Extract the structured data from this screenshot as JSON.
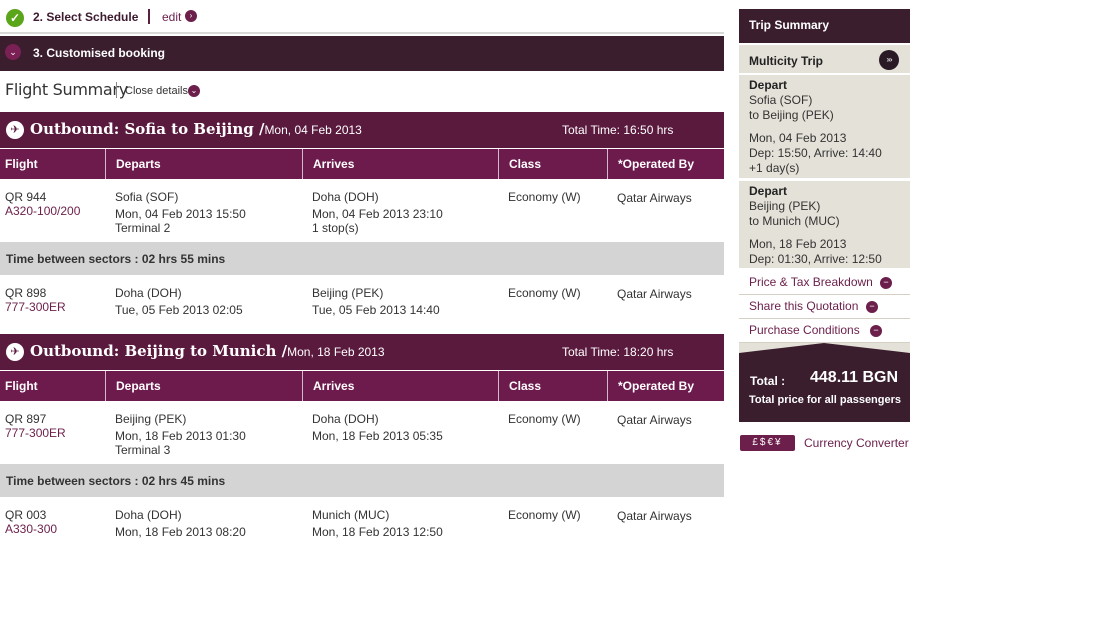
{
  "steps": {
    "step2": {
      "title": "2. Select Schedule",
      "edit": "edit"
    },
    "step3": {
      "title": "3. Customised booking"
    }
  },
  "summary": {
    "title": "Flight Summary",
    "close": "Close details"
  },
  "columns": [
    "Flight",
    "Departs",
    "Arrives",
    "Class",
    "*Operated By"
  ],
  "legs": [
    {
      "title": "Outbound: Sofia  to Beijing /",
      "date": "Mon, 04 Feb 2013",
      "total": "Total Time: 16:50 hrs",
      "segments": [
        {
          "flight": "QR 944",
          "aircraft": "A320-100/200",
          "dep_place": "Sofia (SOF)",
          "dep_time": "Mon, 04 Feb 2013 15:50",
          "dep_extra": "Terminal 2",
          "arr_place": "Doha (DOH)",
          "arr_time": "Mon, 04 Feb 2013 23:10",
          "arr_extra": "1 stop(s)",
          "class": "Economy (W)",
          "operator": "Qatar Airways"
        },
        {
          "flight": "QR 898",
          "aircraft": "777-300ER",
          "dep_place": "Doha (DOH)",
          "dep_time": "Tue, 05 Feb 2013 02:05",
          "dep_extra": "",
          "arr_place": "Beijing (PEK)",
          "arr_time": "Tue, 05 Feb 2013 14:40",
          "arr_extra": "",
          "class": "Economy (W)",
          "operator": "Qatar Airways"
        }
      ],
      "between": "Time between sectors : 02 hrs 55 mins"
    },
    {
      "title": "Outbound: Beijing  to Munich /",
      "date": "Mon, 18 Feb 2013",
      "total": "Total Time: 18:20 hrs",
      "segments": [
        {
          "flight": "QR 897",
          "aircraft": "777-300ER",
          "dep_place": "Beijing (PEK)",
          "dep_time": "Mon, 18 Feb 2013 01:30",
          "dep_extra": "Terminal 3",
          "arr_place": "Doha (DOH)",
          "arr_time": "Mon, 18 Feb 2013 05:35",
          "arr_extra": "",
          "class": "Economy (W)",
          "operator": "Qatar Airways"
        },
        {
          "flight": "QR 003",
          "aircraft": "A330-300",
          "dep_place": "Doha (DOH)",
          "dep_time": "Mon, 18 Feb 2013 08:20",
          "dep_extra": "",
          "arr_place": "Munich (MUC)",
          "arr_time": "Mon, 18 Feb 2013 12:50",
          "arr_extra": "",
          "class": "Economy (W)",
          "operator": "Qatar Airways"
        }
      ],
      "between": "Time between sectors : 02 hrs 45 mins"
    }
  ],
  "trip": {
    "title": "Trip Summary",
    "type": "Multicity Trip",
    "departs": [
      {
        "head": "Depart",
        "from": "Sofia (SOF)",
        "to": "to Beijing (PEK)",
        "date": "Mon, 04 Feb 2013",
        "times": "Dep: 15:50, Arrive: 14:40",
        "extra": "+1 day(s)"
      },
      {
        "head": "Depart",
        "from": "Beijing (PEK)",
        "to": "to Munich (MUC)",
        "date": "Mon, 18 Feb 2013",
        "times": "Dep: 01:30, Arrive: 12:50",
        "extra": ""
      }
    ],
    "links": [
      "Price & Tax Breakdown",
      "Share this Quotation",
      "Purchase Conditions"
    ],
    "total_label": "Total :",
    "total_value": "448.11 BGN",
    "total_sub": "Total price for all passengers",
    "currency_symbols": "£$€¥",
    "currency_link": "Currency Converter"
  },
  "colors": {
    "brand": "#5a1a3e",
    "header": "#6d1a4d",
    "dark": "#3a1e2e",
    "panel": "#e4e1d8"
  }
}
